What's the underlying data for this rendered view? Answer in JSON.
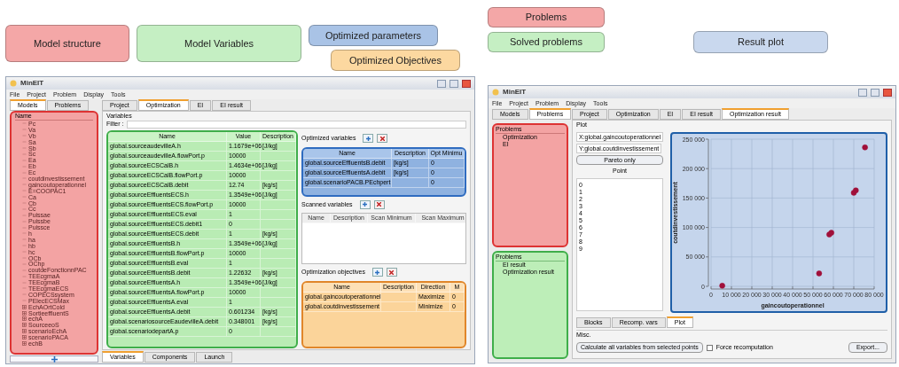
{
  "labels_left": [
    {
      "text": "Model structure",
      "color": "#f4a7a7"
    },
    {
      "text": "Model Variables",
      "color": "#c5efc3"
    },
    {
      "text": "Optimized parameters",
      "color": "#a9c3e6"
    },
    {
      "text": "Optimized Objectives",
      "color": "#fcd8a0"
    }
  ],
  "labels_right": [
    {
      "text": "Problems",
      "color": "#f4a7a7"
    },
    {
      "text": "Solved problems",
      "color": "#c5efc3"
    },
    {
      "text": "Result plot",
      "color": "#c9d8ee"
    }
  ],
  "left_window": {
    "title": "MinEIT",
    "menu": [
      "File",
      "Project",
      "Problem",
      "Display",
      "Tools"
    ],
    "side_tabs": [
      {
        "label": "Models",
        "selected": true
      },
      {
        "label": "Problems",
        "selected": false
      }
    ],
    "tree_header": "Name",
    "tree": [
      {
        "label": "Pc",
        "expandable": false
      },
      {
        "label": "Va",
        "expandable": false
      },
      {
        "label": "Vb",
        "expandable": false
      },
      {
        "label": "Sa",
        "expandable": false
      },
      {
        "label": "Sb",
        "expandable": false
      },
      {
        "label": "Sc",
        "expandable": false
      },
      {
        "label": "Ea",
        "expandable": false
      },
      {
        "label": "Eb",
        "expandable": false
      },
      {
        "label": "Ec",
        "expandable": false
      },
      {
        "label": "coutdinvestissement",
        "expandable": false
      },
      {
        "label": "gaincoutoperationnel",
        "expandable": false
      },
      {
        "label": "E=COOPAC1",
        "expandable": false
      },
      {
        "label": "Ca",
        "expandable": false
      },
      {
        "label": "Cb",
        "expandable": false
      },
      {
        "label": "Cc",
        "expandable": false
      },
      {
        "label": "Puissae",
        "expandable": false
      },
      {
        "label": "Puissbe",
        "expandable": false
      },
      {
        "label": "Puissce",
        "expandable": false
      },
      {
        "label": "h",
        "expandable": false
      },
      {
        "label": "ha",
        "expandable": false
      },
      {
        "label": "hb",
        "expandable": false
      },
      {
        "label": "hc",
        "expandable": false
      },
      {
        "label": "OCb",
        "expandable": false
      },
      {
        "label": "OChp",
        "expandable": false
      },
      {
        "label": "coutdeFonctionnPAC",
        "expandable": false
      },
      {
        "label": "TEEcgmaA",
        "expandable": false
      },
      {
        "label": "TEEcgmaB",
        "expandable": false
      },
      {
        "label": "TEEcgmaECS",
        "expandable": false
      },
      {
        "label": "COPECSsystem",
        "expandable": false
      },
      {
        "label": "PElecECSMax",
        "expandable": false
      },
      {
        "label": "EchAOrtCold",
        "expandable": true
      },
      {
        "label": "SortieeffluentS",
        "expandable": true
      },
      {
        "label": "echA",
        "expandable": true
      },
      {
        "label": "SourceeoS",
        "expandable": true
      },
      {
        "label": "scenarioEchA",
        "expandable": true
      },
      {
        "label": "scenarioPACA",
        "expandable": true
      },
      {
        "label": "echB",
        "expandable": true
      }
    ],
    "main_tabs": [
      {
        "label": "Project",
        "selected": false
      },
      {
        "label": "Optimization",
        "selected": true
      },
      {
        "label": "EI",
        "selected": false
      },
      {
        "label": "EI result",
        "selected": false
      }
    ],
    "section": "Variables",
    "filter_label": "Filter :",
    "variables": {
      "columns": [
        "Name",
        "Value",
        "Description"
      ],
      "rows": [
        [
          "global.sourceaudevilleA.h",
          "1.1679e+06",
          "[J/kg]"
        ],
        [
          "global.sourceaudevilleA.flowPort.p",
          "10000",
          ""
        ],
        [
          "global.sourceECSCalB.h",
          "1.4634e+06",
          "[J/kg]"
        ],
        [
          "global.sourceECSCalB.flowPort.p",
          "10000",
          ""
        ],
        [
          "global.sourceECSCalB.debit",
          "12.74",
          "[kg/s]"
        ],
        [
          "global.sourceEffluentsECS.h",
          "1.3549e+06",
          "[J/kg]"
        ],
        [
          "global.sourceEffluentsECS.flowPort.p",
          "10000",
          ""
        ],
        [
          "global.sourceEffluentsECS.eval",
          "1",
          ""
        ],
        [
          "global.sourceEffluentsECS.debit1",
          "0",
          ""
        ],
        [
          "global.sourceEffluentsECS.debit",
          "1",
          "[kg/s]"
        ],
        [
          "global.sourceEffluentsB.h",
          "1.3549e+06",
          "[J/kg]"
        ],
        [
          "global.sourceEffluentsB.flowPort.p",
          "10000",
          ""
        ],
        [
          "global.sourceEffluentsB.eval",
          "1",
          ""
        ],
        [
          "global.sourceEffluentsB.debit",
          "1.22632",
          "[kg/s]"
        ],
        [
          "global.sourceEffluentsA.h",
          "1.3549e+06",
          "[J/kg]"
        ],
        [
          "global.sourceEffluentsA.flowPort.p",
          "10000",
          ""
        ],
        [
          "global.sourceEffluentsA.eval",
          "1",
          ""
        ],
        [
          "global.sourceEffluentsA.debit",
          "0.601234",
          "[kg/s]"
        ],
        [
          "global.scenariosourceEaudevilleA.debit",
          "0.348001",
          "[kg/s]"
        ],
        [
          "global.scenariodepartA.p",
          "0",
          ""
        ]
      ]
    },
    "optimized": {
      "title": "Optimized variables",
      "columns": [
        "Name",
        "Description",
        "Opt Minimu"
      ],
      "rows": [
        [
          "global.sourceEffluentsB.debit",
          "[kg/s]",
          "0"
        ],
        [
          "global.sourceEffluentsA.debit",
          "[kg/s]",
          "0"
        ],
        [
          "global.scenarioPACB.PEchpert",
          "",
          "0"
        ]
      ]
    },
    "scanned": {
      "title": "Scanned variables",
      "columns": [
        "Name",
        "Description",
        "Scan Minimum",
        "Scan Maximum"
      ]
    },
    "objectives": {
      "title": "Optimization objectives",
      "columns": [
        "Name",
        "Description",
        "Direction",
        "M"
      ],
      "rows": [
        [
          "global.gaincoutoperationnel",
          "",
          "Maximize",
          "0"
        ],
        [
          "global.coutdinvestissement",
          "",
          "Minimize",
          "0"
        ]
      ]
    },
    "bottom_tabs": [
      {
        "label": "Variables",
        "selected": true
      },
      {
        "label": "Components",
        "selected": false
      },
      {
        "label": "Launch",
        "selected": false
      }
    ]
  },
  "right_window": {
    "title": "MinEIT",
    "menu": [
      "File",
      "Project",
      "Problem",
      "Display",
      "Tools"
    ],
    "side_tabs": [
      {
        "label": "Models",
        "selected": false
      },
      {
        "label": "Problems",
        "selected": true
      }
    ],
    "problems": {
      "header": "Problems",
      "items": [
        "Optimization",
        "EI"
      ]
    },
    "solved": {
      "header": "Problems",
      "items": [
        "EI result",
        "Optimization result"
      ]
    },
    "main_tabs": [
      {
        "label": "Project",
        "selected": false
      },
      {
        "label": "Optimization",
        "selected": false
      },
      {
        "label": "EI",
        "selected": false
      },
      {
        "label": "EI result",
        "selected": false
      },
      {
        "label": "Optimization result",
        "selected": true
      }
    ],
    "section": "Plot",
    "x_select": "X:global.gaincoutoperationnel",
    "y_select": "Y:global.coutdinvestissement",
    "pareto_button": "Pareto only",
    "point_header": "Point",
    "points": [
      "0",
      "1",
      "2",
      "3",
      "4",
      "5",
      "6",
      "7",
      "8",
      "9"
    ],
    "chart_data": {
      "type": "scatter",
      "xlabel": "gaincoutoperationnel",
      "ylabel": "coutdinvestissement",
      "xlim": [
        0,
        80000
      ],
      "ylim": [
        0,
        250000
      ],
      "xticks": [
        {
          "value": 0,
          "label": "0"
        },
        {
          "value": 10000,
          "label": "10 000"
        },
        {
          "value": 20000,
          "label": "20 000"
        },
        {
          "value": 30000,
          "label": "30 000"
        },
        {
          "value": 40000,
          "label": "40 000"
        },
        {
          "value": 50000,
          "label": "50 000"
        },
        {
          "value": 60000,
          "label": "60 000"
        },
        {
          "value": 70000,
          "label": "70 000"
        },
        {
          "value": 80000,
          "label": "80 000"
        }
      ],
      "yticks": [
        {
          "value": 0,
          "label": "0"
        },
        {
          "value": 50000,
          "label": "50 000"
        },
        {
          "value": 100000,
          "label": "100 000"
        },
        {
          "value": 150000,
          "label": "150 000"
        },
        {
          "value": 200000,
          "label": "200 000"
        },
        {
          "value": 250000,
          "label": "250 000"
        }
      ],
      "grid": true,
      "x": [
        5500,
        53000,
        58000,
        59000,
        70000,
        71000,
        75500
      ],
      "series": [
        {
          "color": "#a0103a",
          "values": [
            1000,
            22000,
            88000,
            91000,
            159000,
            163000,
            236000
          ]
        }
      ]
    },
    "lower_tabs": [
      {
        "label": "Blocks",
        "selected": false
      },
      {
        "label": "Recomp. vars",
        "selected": false
      },
      {
        "label": "Plot",
        "selected": true
      }
    ],
    "misc": "Misc.",
    "calc_button": "Calculate all variables from selected points",
    "force": {
      "label": "Force recomputation",
      "checked": false
    },
    "export_button": "Export..."
  }
}
